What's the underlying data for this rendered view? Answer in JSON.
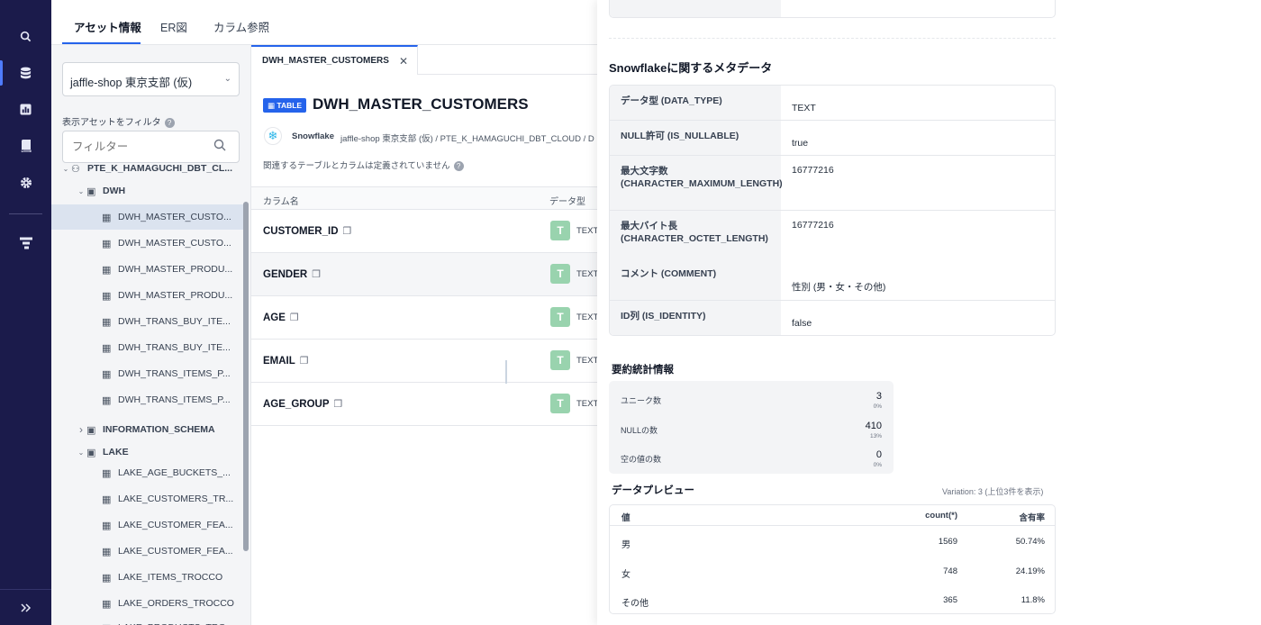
{
  "top_tabs": [
    "アセット情報",
    "ER図",
    "カラム参照"
  ],
  "sidebar": {
    "selector_value": "jaffle-shop 東京支部 (仮)",
    "filter_label": "表示アセットをフィルタ",
    "filter_placeholder": "フィルター",
    "tree": [
      {
        "label": "PTE_K_HAMAGUCHI_DBT_CL...",
        "type": "database",
        "level": 0,
        "caret": "down"
      },
      {
        "label": "DWH",
        "type": "schema",
        "level": 1,
        "caret": "down"
      },
      {
        "label": "DWH_MASTER_CUSTO...",
        "type": "table",
        "level": 2,
        "selected": true
      },
      {
        "label": "DWH_MASTER_CUSTO...",
        "type": "table",
        "level": 2
      },
      {
        "label": "DWH_MASTER_PRODU...",
        "type": "table",
        "level": 2
      },
      {
        "label": "DWH_MASTER_PRODU...",
        "type": "table",
        "level": 2
      },
      {
        "label": "DWH_TRANS_BUY_ITE...",
        "type": "table",
        "level": 2
      },
      {
        "label": "DWH_TRANS_BUY_ITE...",
        "type": "table",
        "level": 2
      },
      {
        "label": "DWH_TRANS_ITEMS_P...",
        "type": "table",
        "level": 2
      },
      {
        "label": "DWH_TRANS_ITEMS_P...",
        "type": "table",
        "level": 2
      },
      {
        "label": "INFORMATION_SCHEMA",
        "type": "schema",
        "level": 1,
        "caret": "right"
      },
      {
        "label": "LAKE",
        "type": "schema",
        "level": 1,
        "caret": "down"
      },
      {
        "label": "LAKE_AGE_BUCKETS_...",
        "type": "table",
        "level": 2
      },
      {
        "label": "LAKE_CUSTOMERS_TR...",
        "type": "table",
        "level": 2
      },
      {
        "label": "LAKE_CUSTOMER_FEA...",
        "type": "table",
        "level": 2
      },
      {
        "label": "LAKE_CUSTOMER_FEA...",
        "type": "table",
        "level": 2
      },
      {
        "label": "LAKE_ITEMS_TROCCO",
        "type": "table",
        "level": 2
      },
      {
        "label": "LAKE_ORDERS_TROCCO",
        "type": "table",
        "level": 2
      },
      {
        "label": "LAKE_PRODUCTS_TRO...",
        "type": "table",
        "level": 2
      }
    ]
  },
  "main": {
    "open_tab": "DWH_MASTER_CUSTOMERS",
    "badge": "TABLE",
    "title": "DWH_MASTER_CUSTOMERS",
    "source": "Snowflake",
    "path": "jaffle-shop 東京支部 (仮) / PTE_K_HAMAGUCHI_DBT_CLOUD / D",
    "no_related": "関連するテーブルとカラムは定義されていません",
    "col_header_name": "カラム名",
    "col_header_type": "データ型",
    "columns": [
      {
        "name": "CUSTOMER_ID",
        "type_letter": "T",
        "type": "TEXT"
      },
      {
        "name": "GENDER",
        "type_letter": "T",
        "type": "TEXT"
      },
      {
        "name": "AGE",
        "type_letter": "T",
        "type": "TEXT"
      },
      {
        "name": "EMAIL",
        "type_letter": "T",
        "type": "TEXT"
      },
      {
        "name": "AGE_GROUP",
        "type_letter": "T",
        "type": "TEXT"
      }
    ]
  },
  "panel": {
    "meta_title": "Snowflakeに関するメタデータ",
    "meta": [
      {
        "key": "データ型 (DATA_TYPE)",
        "value": "TEXT"
      },
      {
        "key": "NULL許可 (IS_NULLABLE)",
        "value": "true"
      },
      {
        "key": "最大文字数 (CHARACTER_MAXIMUM_LENGTH)",
        "value": "16777216"
      },
      {
        "key": "最大バイト長 (CHARACTER_OCTET_LENGTH)",
        "value": "16777216"
      },
      {
        "key": "コメント (COMMENT)",
        "value": "性別 (男・女・その他)"
      },
      {
        "key": "ID列 (IS_IDENTITY)",
        "value": "false"
      }
    ],
    "stats_title": "要約統計情報",
    "stats": [
      {
        "label": "ユニーク数",
        "value": "3",
        "pct": "0%"
      },
      {
        "label": "NULLの数",
        "value": "410",
        "pct": "13%"
      },
      {
        "label": "空の値の数",
        "value": "0",
        "pct": "0%"
      }
    ],
    "preview_title": "データプレビュー",
    "variation": "Variation: 3 (上位3件を表示)",
    "preview_headers": [
      "値",
      "count(*)",
      "含有率"
    ],
    "preview_rows": [
      {
        "value": "男",
        "count": "1569",
        "rate": "50.74%"
      },
      {
        "value": "女",
        "count": "748",
        "rate": "24.19%"
      },
      {
        "value": "その他",
        "count": "365",
        "rate": "11.8%"
      }
    ]
  },
  "colors": {
    "rail": "#1b1b4b",
    "accent": "#2563eb",
    "type_badge": "#99d3ae"
  }
}
